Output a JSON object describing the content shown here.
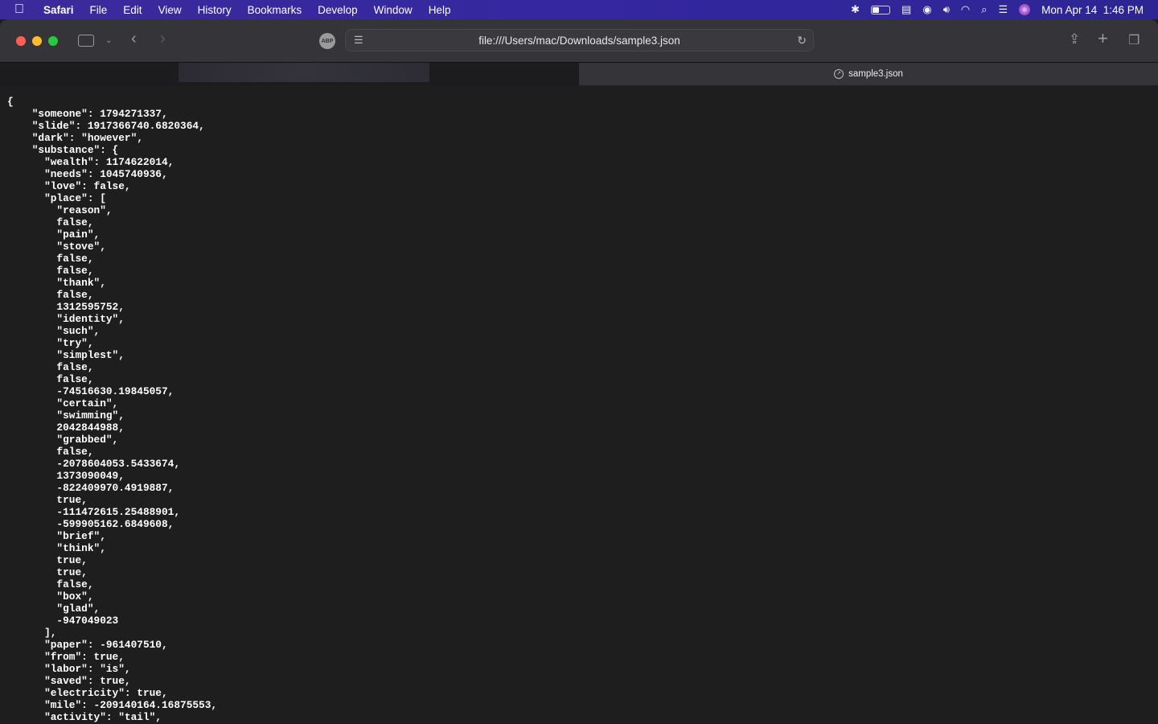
{
  "menubar": {
    "app": "Safari",
    "items": [
      "File",
      "Edit",
      "View",
      "History",
      "Bookmarks",
      "Develop",
      "Window",
      "Help"
    ],
    "clock": "Mon Apr 14  1:46 PM"
  },
  "toolbar": {
    "url": "file:///Users/mac/Downloads/sample3.json",
    "abp": "ABP"
  },
  "tab": {
    "title": "sample3.json"
  },
  "colors": {
    "menubar": "#3427a0",
    "toolbar": "#353438",
    "content": "#1e1e1e",
    "close": "#fe5f57",
    "minimize": "#febc2e",
    "zoom": "#28c840"
  },
  "json_lines": [
    "{",
    "    \"someone\": 1794271337,",
    "    \"slide\": 1917366740.6820364,",
    "    \"dark\": \"however\",",
    "    \"substance\": {",
    "      \"wealth\": 1174622014,",
    "      \"needs\": 1045740936,",
    "      \"love\": false,",
    "      \"place\": [",
    "        \"reason\",",
    "        false,",
    "        \"pain\",",
    "        \"stove\",",
    "        false,",
    "        false,",
    "        \"thank\",",
    "        false,",
    "        1312595752,",
    "        \"identity\",",
    "        \"such\",",
    "        \"try\",",
    "        \"simplest\",",
    "        false,",
    "        false,",
    "        -74516630.19845057,",
    "        \"certain\",",
    "        \"swimming\",",
    "        2042844988,",
    "        \"grabbed\",",
    "        false,",
    "        -2078604053.5433674,",
    "        1373090049,",
    "        -822409970.4919887,",
    "        true,",
    "        -111472615.25488901,",
    "        -599905162.6849608,",
    "        \"brief\",",
    "        \"think\",",
    "        true,",
    "        true,",
    "        false,",
    "        \"box\",",
    "        \"glad\",",
    "        -947049023",
    "      ],",
    "      \"paper\": -961407510,",
    "      \"from\": true,",
    "      \"labor\": \"is\",",
    "      \"saved\": true,",
    "      \"electricity\": true,",
    "      \"mile\": -209140164.16875553,",
    "      \"activity\": \"tail\","
  ]
}
